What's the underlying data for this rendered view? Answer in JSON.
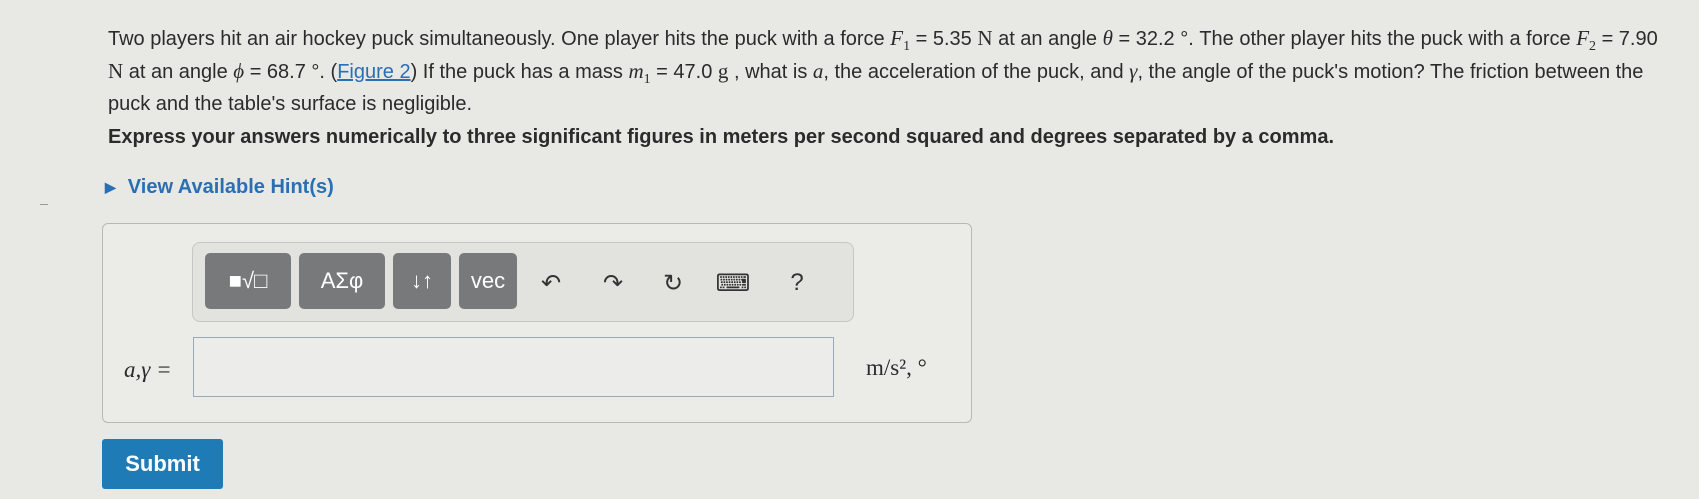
{
  "problem": {
    "p1": "Two players hit an air hockey puck simultaneously.  One player hits the puck with a force ",
    "F1_sym": "F",
    "F1_sub": "1",
    "F1_val": " = 5.35 ",
    "N": "N",
    "p2": " at an angle ",
    "theta": "θ",
    "theta_val": " = 32.2 °",
    "p3": ". The other player hits the puck with a force ",
    "F2_sym": "F",
    "F2_sub": "2",
    "F2_val": " = 7.90 ",
    "p4": " at an angle ",
    "phi": "ϕ",
    "phi_val": " = 68.7 °",
    "p5": ". (",
    "figure_link": "Figure 2",
    "p6": ") If the puck has a mass ",
    "m_sym": "m",
    "m_sub": "1",
    "m_val": " = 47.0 ",
    "g": "g",
    "p7": " , what is ",
    "a": "a",
    "p8": ", the acceleration of the puck, and ",
    "gamma": "γ",
    "p9": ", the angle of the puck's motion?  The friction between the puck and the table's surface is negligible."
  },
  "instructions": "Express your answers numerically to three significant figures in meters per second squared and degrees separated by a comma.",
  "hint": {
    "label": "View Available Hint(s)"
  },
  "toolbar": {
    "templates": "■√□",
    "greek": "ΑΣφ",
    "arrows": "↓↑",
    "vec": "vec",
    "undo": "↶",
    "redo": "↷",
    "reset": "↻",
    "keyboard": "⌨",
    "help": "?"
  },
  "answer": {
    "label": "a,γ =",
    "value": "",
    "units": "m/s², °"
  },
  "submit": "Submit"
}
